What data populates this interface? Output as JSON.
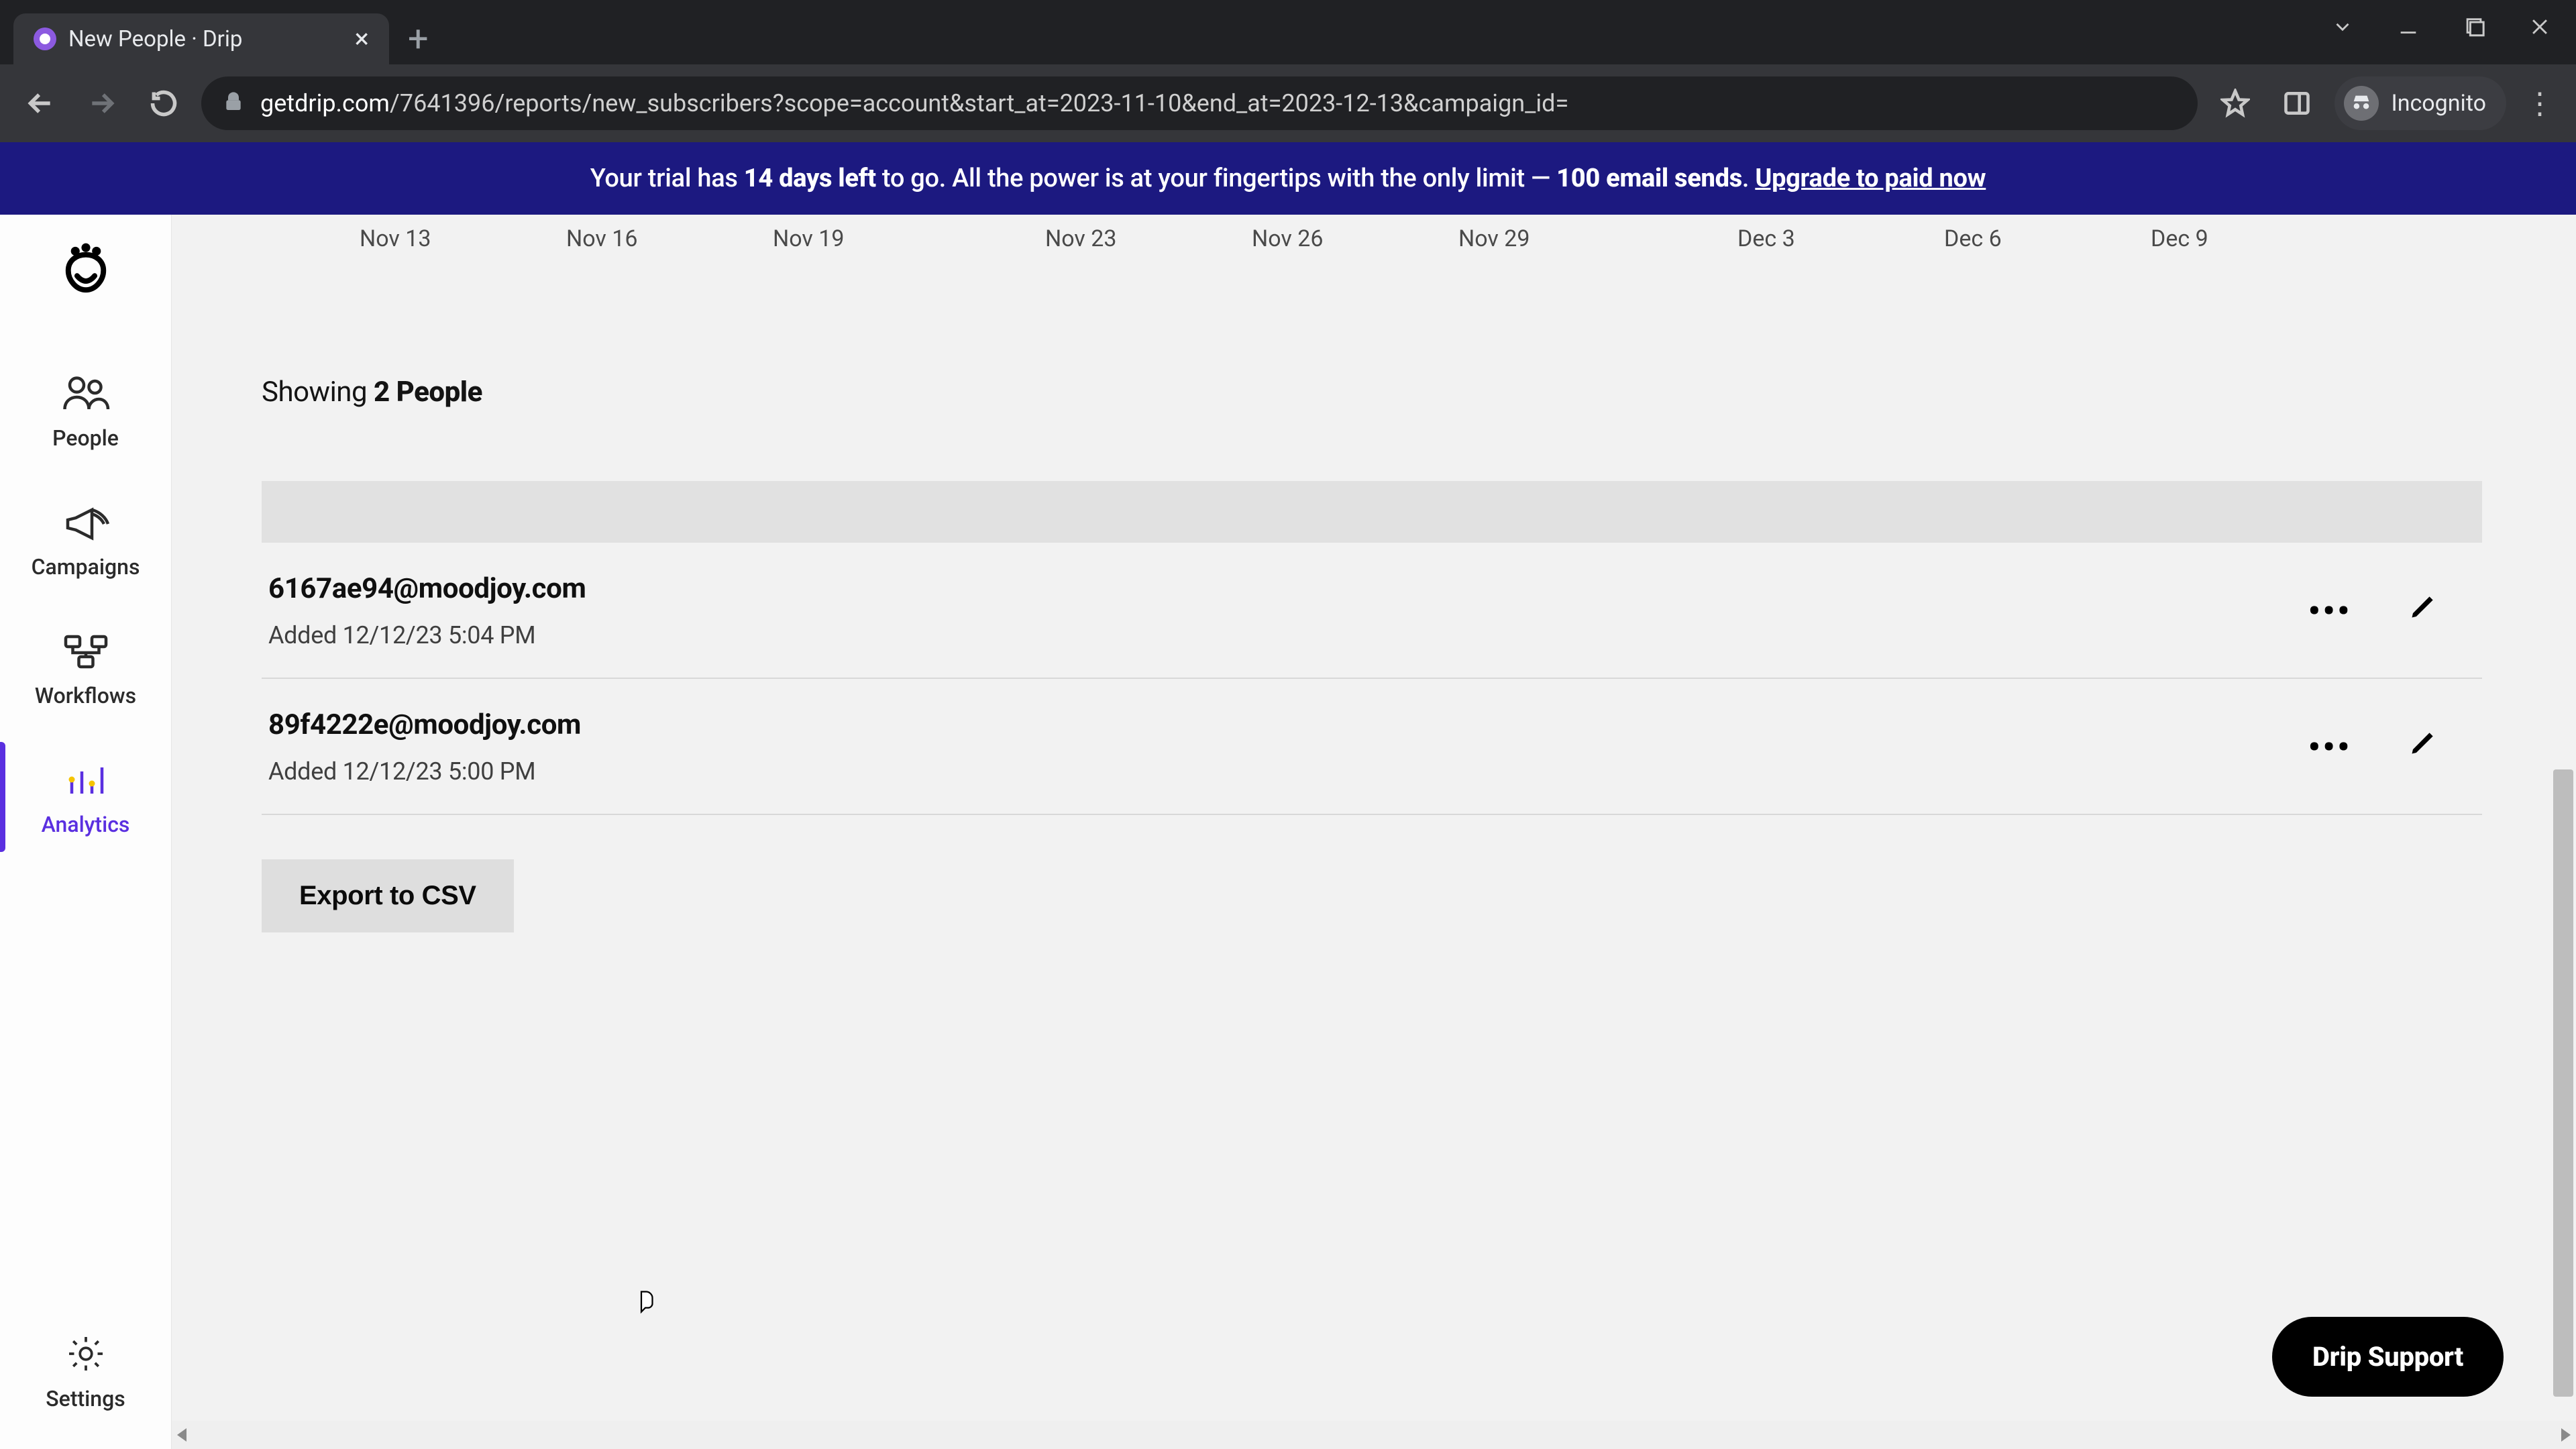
{
  "browser": {
    "tab_title": "New People · Drip",
    "url_domain": "getdrip.com",
    "url_path": "/7641396/reports/new_subscribers?scope=account&start_at=2023-11-10&end_at=2023-12-13&campaign_id=",
    "incognito_label": "Incognito"
  },
  "banner": {
    "pre": "Your trial has ",
    "bold1": "14 days left",
    "mid": " to go. All the power is at your fingertips with the only limit — ",
    "bold2": "100 email sends",
    "post": ". ",
    "link": "Upgrade to paid now"
  },
  "sidebar": {
    "people": "People",
    "campaigns": "Campaigns",
    "workflows": "Workflows",
    "analytics": "Analytics",
    "settings": "Settings"
  },
  "axis": [
    "Nov 13",
    "Nov 16",
    "Nov 19",
    "Nov 23",
    "Nov 26",
    "Nov 29",
    "Dec 3",
    "Dec 6",
    "Dec 9"
  ],
  "showing": {
    "prefix": "Showing ",
    "count": "2 People"
  },
  "people": [
    {
      "email": "6167ae94@moodjoy.com",
      "added": "Added 12/12/23 5:04 PM"
    },
    {
      "email": "89f4222e@moodjoy.com",
      "added": "Added 12/12/23 5:00 PM"
    }
  ],
  "export_label": "Export to CSV",
  "support_label": "Drip Support"
}
